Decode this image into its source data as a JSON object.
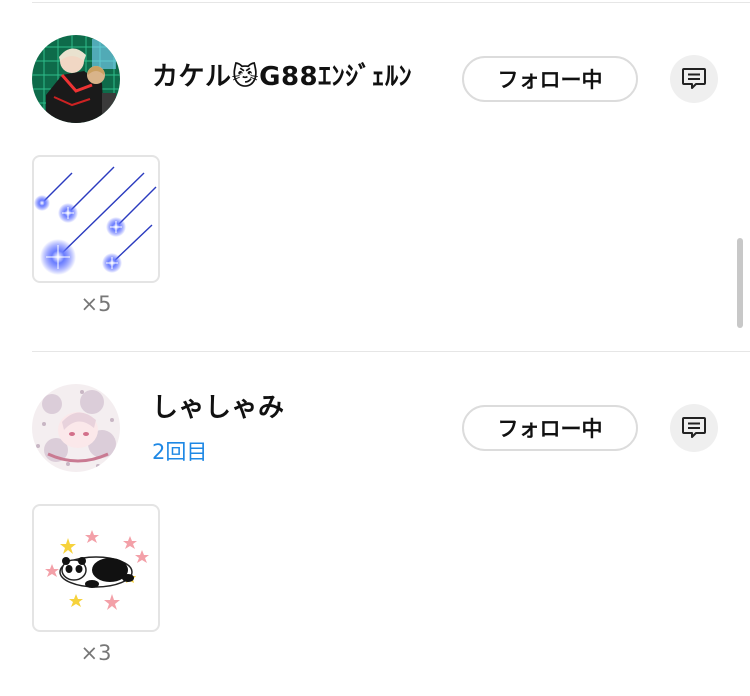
{
  "users": [
    {
      "name": "カケル",
      "name_emoji": "😼",
      "name_suffix": "G88ｴﾝｼﾞｪﾙﾝ",
      "subtext": "",
      "follow_label": "フォロー中",
      "message_icon": "message-icon",
      "gift_icon": "shooting-stars",
      "gift_count": "×5"
    },
    {
      "name": "しゃしゃみ",
      "name_emoji": "",
      "name_suffix": "",
      "subtext": "2回目",
      "follow_label": "フォロー中",
      "message_icon": "message-icon",
      "gift_icon": "panda-stars",
      "gift_count": "×3"
    }
  ],
  "colors": {
    "accent": "#1e88e5",
    "divider": "#e6e6e6",
    "button_border": "#dcdcdc"
  }
}
